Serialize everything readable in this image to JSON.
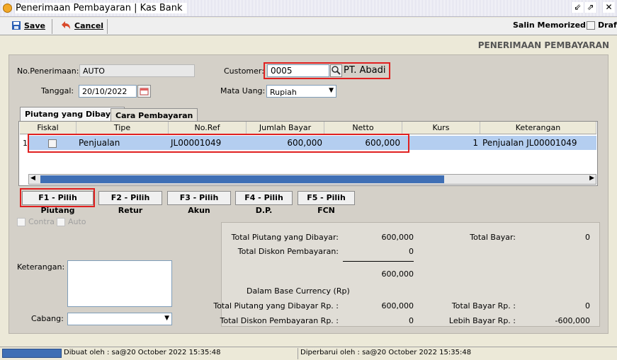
{
  "window": {
    "title": "Penerimaan Pembayaran | Kas Bank"
  },
  "toolbar": {
    "save_label": "Save",
    "cancel_label": "Cancel",
    "salin_label": "Salin Memorized",
    "draft_label": "Draft"
  },
  "form": {
    "heading": "PENERIMAAN PEMBAYARAN",
    "no_penerimaan_label": "No.Penerimaan:",
    "no_penerimaan_value": "AUTO",
    "tanggal_label": "Tanggal:",
    "tanggal_value": "20/10/2022",
    "customer_label": "Customer:",
    "customer_code": "0005",
    "customer_name": "PT. Abadi",
    "mata_uang_label": "Mata Uang:",
    "mata_uang_value": "Rupiah"
  },
  "tabs": [
    {
      "label": "Piutang yang Dibayar"
    },
    {
      "label": "Cara Pembayaran"
    }
  ],
  "grid": {
    "columns": [
      "Fiskal",
      "Tipe",
      "No.Ref",
      "Jumlah Bayar",
      "Netto",
      "Kurs",
      "Keterangan"
    ],
    "rows": [
      {
        "no": "1",
        "tipe": "Penjualan",
        "no_ref": "JL00001049",
        "jumlah_bayar": "600,000",
        "netto": "600,000",
        "kurs": "1",
        "keterangan": "Penjualan JL00001049"
      }
    ]
  },
  "buttons": {
    "f1": "F1 - Pilih Piutang",
    "f2": "F2 - Pilih Retur",
    "f3": "F3 - Pilih Akun",
    "f4": "F4 - Pilih D.P.",
    "f5": "F5 - Pilih FCN"
  },
  "options": {
    "contra": "Contra",
    "auto": "Auto"
  },
  "keterangan_label": "Keterangan:",
  "cabang_label": "Cabang:",
  "summary": {
    "total_piutang_label": "Total Piutang yang Dibayar:",
    "total_piutang_value": "600,000",
    "total_diskon_label": "Total Diskon Pembayaran:",
    "total_diskon_value": "0",
    "subtotal_value": "600,000",
    "total_bayar_label": "Total Bayar:",
    "total_bayar_value": "0",
    "base_currency_label": "Dalam Base Currency (Rp)",
    "total_piutang_rp_label": "Total Piutang yang Dibayar Rp. :",
    "total_piutang_rp_value": "600,000",
    "total_diskon_rp_label": "Total Diskon Pembayaran Rp. :",
    "total_diskon_rp_value": "0",
    "total_bayar_rp_label": "Total Bayar Rp. :",
    "total_bayar_rp_value": "0",
    "lebih_bayar_rp_label": "Lebih Bayar Rp. :",
    "lebih_bayar_rp_value": "-600,000"
  },
  "status": {
    "dibuat": "Dibuat oleh : sa@20 October 2022  15:35:48",
    "diperbarui": "Diperbarui oleh : sa@20 October 2022  15:35:48"
  }
}
